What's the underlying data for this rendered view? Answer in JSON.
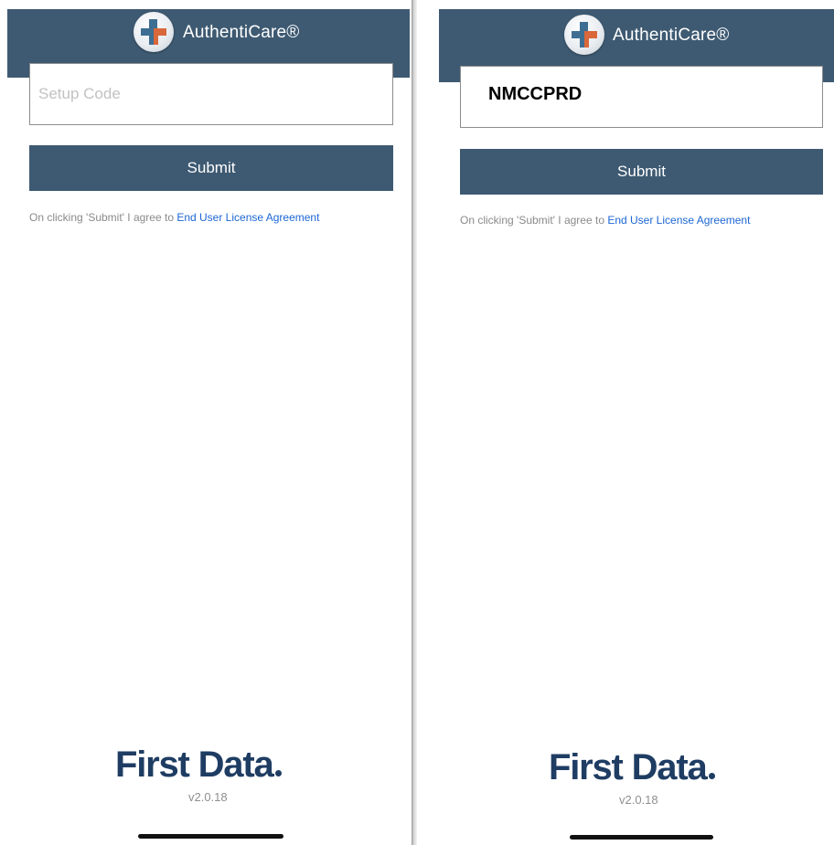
{
  "screens": [
    {
      "app_title": "AuthentiCare®",
      "input": {
        "value": "",
        "placeholder": "Setup Code"
      },
      "submit_label": "Submit",
      "eula_text": "On clicking 'Submit' I agree to ",
      "eula_link": "End User License Agreement",
      "brand": "First Data",
      "version": "v2.0.18"
    },
    {
      "app_title": "AuthentiCare®",
      "input": {
        "value": "NMCCPRD",
        "placeholder": ""
      },
      "submit_label": "Submit",
      "eula_text": "On clicking 'Submit' I agree to ",
      "eula_link": "End User License Agreement",
      "brand": "First Data",
      "version": "v2.0.18"
    }
  ],
  "colors": {
    "header": "#3e5a72",
    "button": "#3e5a72",
    "link": "#1c66d4",
    "brand": "#1f3d63",
    "logo_cross_left": "#3e6f93",
    "logo_cross_right": "#d9683b"
  },
  "icons": {
    "logo": "medical-cross-logo-icon"
  }
}
